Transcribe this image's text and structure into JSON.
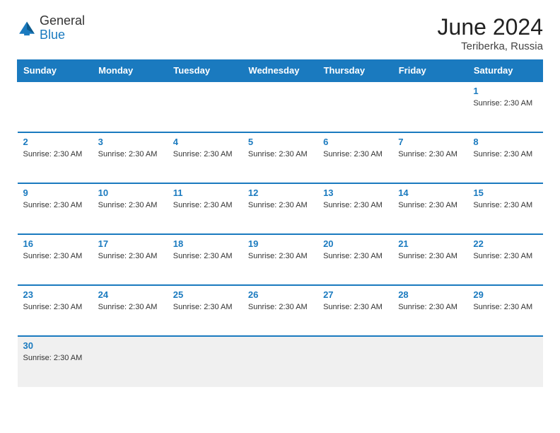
{
  "header": {
    "logo_general": "General",
    "logo_blue": "Blue",
    "month_year": "June 2024",
    "location": "Teriberka, Russia"
  },
  "weekdays": [
    "Sunday",
    "Monday",
    "Tuesday",
    "Wednesday",
    "Thursday",
    "Friday",
    "Saturday"
  ],
  "weeks": [
    [
      {
        "day": null,
        "info": null
      },
      {
        "day": null,
        "info": null
      },
      {
        "day": null,
        "info": null
      },
      {
        "day": null,
        "info": null
      },
      {
        "day": null,
        "info": null
      },
      {
        "day": null,
        "info": null
      },
      {
        "day": "1",
        "info": "Sunrise: 2:30 AM"
      }
    ],
    [
      {
        "day": "2",
        "info": "Sunrise: 2:30 AM"
      },
      {
        "day": "3",
        "info": "Sunrise: 2:30 AM"
      },
      {
        "day": "4",
        "info": "Sunrise: 2:30 AM"
      },
      {
        "day": "5",
        "info": "Sunrise: 2:30 AM"
      },
      {
        "day": "6",
        "info": "Sunrise: 2:30 AM"
      },
      {
        "day": "7",
        "info": "Sunrise: 2:30 AM"
      },
      {
        "day": "8",
        "info": "Sunrise: 2:30 AM"
      }
    ],
    [
      {
        "day": "9",
        "info": "Sunrise: 2:30 AM"
      },
      {
        "day": "10",
        "info": "Sunrise: 2:30 AM"
      },
      {
        "day": "11",
        "info": "Sunrise: 2:30 AM"
      },
      {
        "day": "12",
        "info": "Sunrise: 2:30 AM"
      },
      {
        "day": "13",
        "info": "Sunrise: 2:30 AM"
      },
      {
        "day": "14",
        "info": "Sunrise: 2:30 AM"
      },
      {
        "day": "15",
        "info": "Sunrise: 2:30 AM"
      }
    ],
    [
      {
        "day": "16",
        "info": "Sunrise: 2:30 AM"
      },
      {
        "day": "17",
        "info": "Sunrise: 2:30 AM"
      },
      {
        "day": "18",
        "info": "Sunrise: 2:30 AM"
      },
      {
        "day": "19",
        "info": "Sunrise: 2:30 AM"
      },
      {
        "day": "20",
        "info": "Sunrise: 2:30 AM"
      },
      {
        "day": "21",
        "info": "Sunrise: 2:30 AM"
      },
      {
        "day": "22",
        "info": "Sunrise: 2:30 AM"
      }
    ],
    [
      {
        "day": "23",
        "info": "Sunrise: 2:30 AM"
      },
      {
        "day": "24",
        "info": "Sunrise: 2:30 AM"
      },
      {
        "day": "25",
        "info": "Sunrise: 2:30 AM"
      },
      {
        "day": "26",
        "info": "Sunrise: 2:30 AM"
      },
      {
        "day": "27",
        "info": "Sunrise: 2:30 AM"
      },
      {
        "day": "28",
        "info": "Sunrise: 2:30 AM"
      },
      {
        "day": "29",
        "info": "Sunrise: 2:30 AM"
      }
    ],
    [
      {
        "day": "30",
        "info": "Sunrise: 2:30 AM"
      },
      {
        "day": null,
        "info": null
      },
      {
        "day": null,
        "info": null
      },
      {
        "day": null,
        "info": null
      },
      {
        "day": null,
        "info": null
      },
      {
        "day": null,
        "info": null
      },
      {
        "day": null,
        "info": null
      }
    ]
  ]
}
